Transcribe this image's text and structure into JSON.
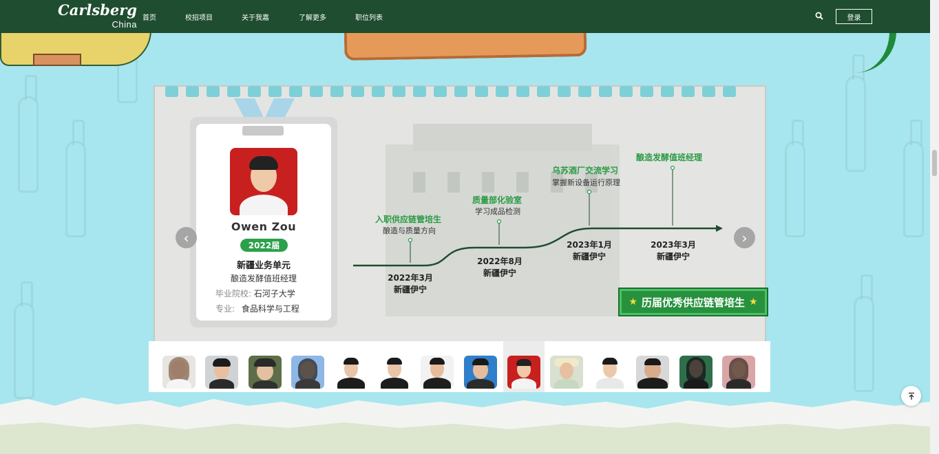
{
  "header": {
    "brand": "Carlsberg",
    "brand_sub": "China",
    "nav": [
      "首页",
      "校招项目",
      "关于我嘉",
      "了解更多",
      "职位列表"
    ],
    "login_label": "登录"
  },
  "profile": {
    "name": "Owen Zou",
    "year": "2022届",
    "unit": "新疆业务单元",
    "role": "酿造发酵值班经理",
    "school_label": "毕业院校:",
    "school": "石河子大学",
    "major_label": "专业:",
    "major": "食品科学与工程"
  },
  "timeline": [
    {
      "title": "入职供应链管培生",
      "sub": "酿造与质量方向",
      "date": "2022年3月",
      "place": "新疆伊宁"
    },
    {
      "title": "质量部化验室",
      "sub": "学习成品检测",
      "date": "2022年8月",
      "place": "新疆伊宁"
    },
    {
      "title": "乌苏酒厂交流学习",
      "sub": "掌握新设备运行原理",
      "date": "2023年1月",
      "place": "新疆伊宁"
    },
    {
      "title": "酿造发酵值班经理",
      "sub": "",
      "date": "2023年3月",
      "place": "新疆伊宁"
    }
  ],
  "history_button": "历届优秀供应链管培生",
  "colors": {
    "brand_green": "#1e4d2f",
    "accent_green": "#2ca04a",
    "sky": "#a7e6ee"
  }
}
